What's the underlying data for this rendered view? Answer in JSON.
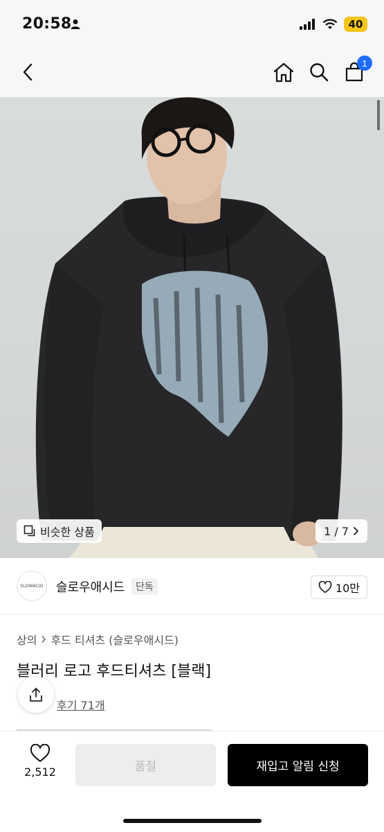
{
  "status": {
    "time": "20:58",
    "battery": "40"
  },
  "nav": {
    "cart_count": "1"
  },
  "hero": {
    "similar_label": "비슷한 상품",
    "counter": "1 / 7"
  },
  "brand": {
    "logo_text": "SLOWACID",
    "name": "슬로우애시드",
    "tag": "단독",
    "likes": "10만"
  },
  "breadcrumb": {
    "items": [
      "상의",
      "후드 티셔츠 (슬로우애시드)"
    ]
  },
  "product": {
    "title": "블러리 로고 후드티셔츠 [블랙]",
    "reviews": "후기 71개"
  },
  "bottom": {
    "wish_count": "2,512",
    "soldout_label": "품절",
    "restock_label": "재입고 알림 신청"
  },
  "colors": {
    "accent": "#1e6bff",
    "battery": "#f5c518",
    "cta": "#000000"
  }
}
